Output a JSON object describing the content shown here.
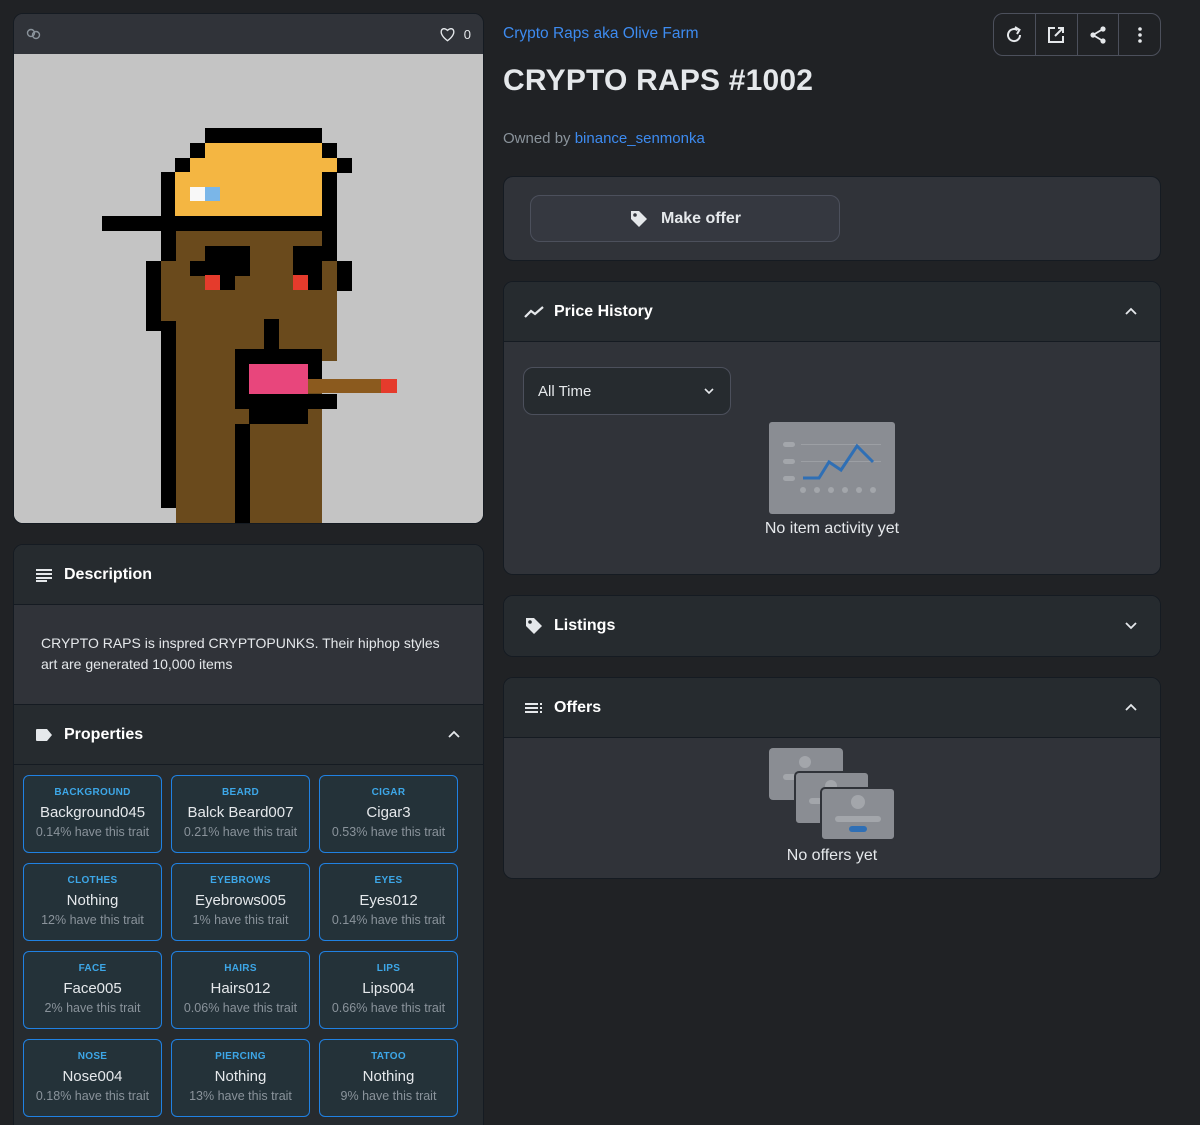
{
  "asset": {
    "favorites": "0",
    "collection": "Crypto Raps aka Olive Farm",
    "title": "CRYPTO RAPS #1002",
    "owned_prefix": "Owned by",
    "owner": "binance_senmonka"
  },
  "toolbar": {
    "icons": [
      "refresh-icon",
      "external-link-icon",
      "share-icon",
      "more-icon"
    ]
  },
  "description": {
    "heading": "Description",
    "text": "CRYPTO RAPS is inspred CRYPTOPUNKS. Their hiphop styles art are generated 10,000 items"
  },
  "properties": {
    "heading": "Properties",
    "items": [
      {
        "type": "BACKGROUND",
        "value": "Background045",
        "rarity": "0.14% have this trait"
      },
      {
        "type": "BEARD",
        "value": "Balck Beard007",
        "rarity": "0.21% have this trait"
      },
      {
        "type": "CIGAR",
        "value": "Cigar3",
        "rarity": "0.53% have this trait"
      },
      {
        "type": "CLOTHES",
        "value": "Nothing",
        "rarity": "12% have this trait"
      },
      {
        "type": "EYEBROWS",
        "value": "Eyebrows005",
        "rarity": "1% have this trait"
      },
      {
        "type": "EYES",
        "value": "Eyes012",
        "rarity": "0.14% have this trait"
      },
      {
        "type": "FACE",
        "value": "Face005",
        "rarity": "2% have this trait"
      },
      {
        "type": "HAIRS",
        "value": "Hairs012",
        "rarity": "0.06% have this trait"
      },
      {
        "type": "LIPS",
        "value": "Lips004",
        "rarity": "0.66% have this trait"
      },
      {
        "type": "NOSE",
        "value": "Nose004",
        "rarity": "0.18% have this trait"
      },
      {
        "type": "PIERCING",
        "value": "Nothing",
        "rarity": "13% have this trait"
      },
      {
        "type": "TATOO",
        "value": "Nothing",
        "rarity": "9% have this trait"
      }
    ]
  },
  "offer": {
    "button": "Make offer"
  },
  "price_history": {
    "heading": "Price History",
    "range_selected": "All Time",
    "empty_text": "No item activity yet"
  },
  "listings": {
    "heading": "Listings"
  },
  "offers": {
    "heading": "Offers",
    "empty_text": "No offers yet"
  },
  "colors": {
    "background": "#202225",
    "panel": "#303339",
    "panel_header": "#262b2f",
    "accent": "#2081e2",
    "link": "#3d8bf0",
    "muted": "#8a939b"
  }
}
